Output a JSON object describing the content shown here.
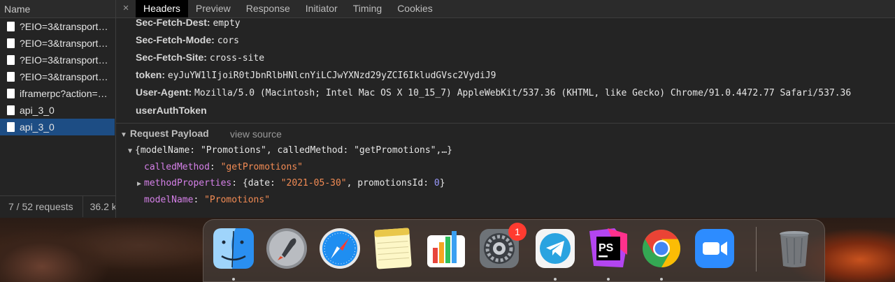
{
  "list": {
    "header": "Name",
    "requests": [
      {
        "name": "?EIO=3&transport…",
        "selected": false
      },
      {
        "name": "?EIO=3&transport…",
        "selected": false
      },
      {
        "name": "?EIO=3&transport…",
        "selected": false
      },
      {
        "name": "?EIO=3&transport…",
        "selected": false
      },
      {
        "name": "iframerpc?action=…",
        "selected": false
      },
      {
        "name": "api_3_0",
        "selected": false
      },
      {
        "name": "api_3_0",
        "selected": true
      }
    ],
    "footer_count": "7 / 52 requests",
    "footer_size": "36.2 k"
  },
  "tabs": {
    "close": "×",
    "items": [
      "Headers",
      "Preview",
      "Response",
      "Initiator",
      "Timing",
      "Cookies"
    ],
    "active": "Headers"
  },
  "headers": [
    {
      "key": "Sec-Fetch-Dest:",
      "value": "empty"
    },
    {
      "key": "Sec-Fetch-Mode:",
      "value": "cors"
    },
    {
      "key": "Sec-Fetch-Site:",
      "value": "cross-site"
    },
    {
      "key": "token:",
      "value": "eyJuYW1lIjoiR0tJbnRlbHNlcnYiLCJwYXNzd29yZCI6IkludGVsc2VydiJ9"
    },
    {
      "key": "User-Agent:",
      "value": "Mozilla/5.0 (Macintosh; Intel Mac OS X 10_15_7) AppleWebKit/537.36 (KHTML, like Gecko) Chrome/91.0.4472.77 Safari/537.36"
    },
    {
      "key": "userAuthToken",
      "value": ""
    }
  ],
  "payload": {
    "title": "Request Payload",
    "view_source": "view source",
    "summary": "{modelName: \"Promotions\", calledMethod: \"getPromotions\",…}",
    "called_method_key": "calledMethod",
    "called_method_value": "\"getPromotions\"",
    "method_props_key": "methodProperties",
    "method_props_open": "{date: ",
    "method_props_date": "\"2021-05-30\"",
    "method_props_mid": ", promotionsId: ",
    "method_props_id": "0",
    "method_props_close": "}",
    "model_name_key": "modelName",
    "model_name_value": "\"Promotions\"",
    "colon": ": "
  },
  "dock": {
    "apps": [
      "finder-icon",
      "launchpad-icon",
      "safari-icon",
      "notes-icon",
      "numbers-icon",
      "system-preferences-icon",
      "telegram-icon",
      "phpstorm-icon",
      "chrome-icon",
      "zoom-icon",
      "trash-icon"
    ],
    "settings_badge": "1",
    "phpstorm_label": "PS"
  }
}
